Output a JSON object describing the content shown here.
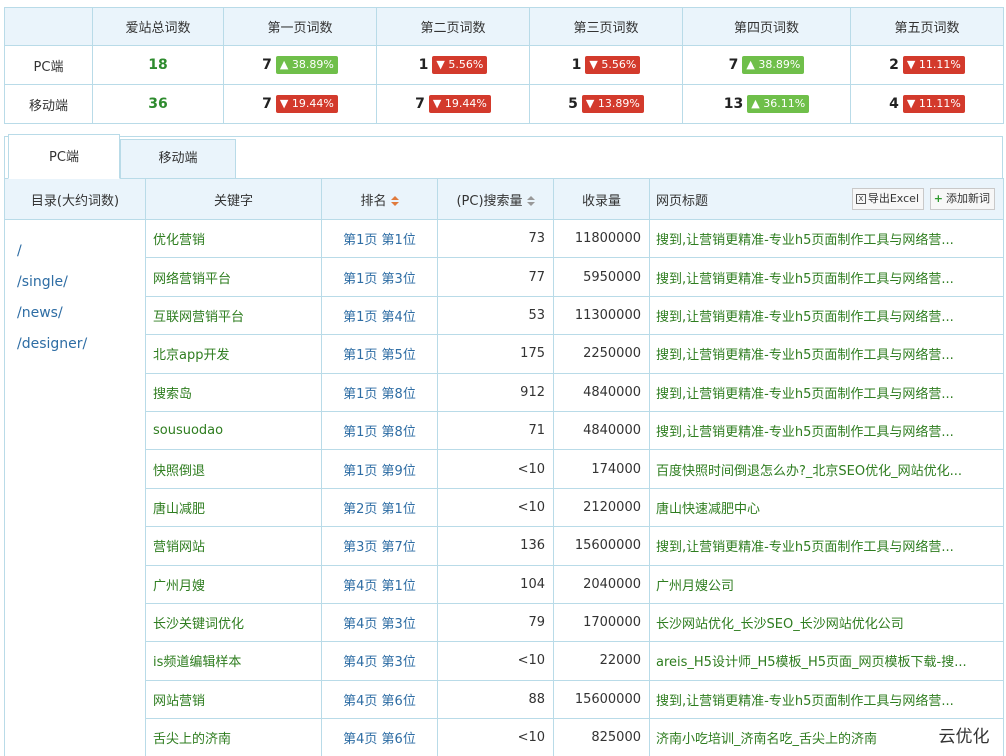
{
  "summary": {
    "headers": [
      "",
      "爱站总词数",
      "第一页词数",
      "第二页词数",
      "第三页词数",
      "第四页词数",
      "第五页词数"
    ],
    "rows": [
      {
        "label": "PC端",
        "total": "18",
        "pages": [
          {
            "count": "7",
            "pct": "38.89%",
            "dir": "up",
            "arrow": "▲"
          },
          {
            "count": "1",
            "pct": "5.56%",
            "dir": "down",
            "arrow": "▼"
          },
          {
            "count": "1",
            "pct": "5.56%",
            "dir": "down",
            "arrow": "▼"
          },
          {
            "count": "7",
            "pct": "38.89%",
            "dir": "up",
            "arrow": "▲"
          },
          {
            "count": "2",
            "pct": "11.11%",
            "dir": "down",
            "arrow": "▼"
          }
        ]
      },
      {
        "label": "移动端",
        "total": "36",
        "pages": [
          {
            "count": "7",
            "pct": "19.44%",
            "dir": "down",
            "arrow": "▼"
          },
          {
            "count": "7",
            "pct": "19.44%",
            "dir": "down",
            "arrow": "▼"
          },
          {
            "count": "5",
            "pct": "13.89%",
            "dir": "down",
            "arrow": "▼"
          },
          {
            "count": "13",
            "pct": "36.11%",
            "dir": "up",
            "arrow": "▲"
          },
          {
            "count": "4",
            "pct": "11.11%",
            "dir": "down",
            "arrow": "▼"
          }
        ]
      }
    ]
  },
  "tabs": [
    {
      "label": "PC端",
      "active": true
    },
    {
      "label": "移动端",
      "active": false
    }
  ],
  "table": {
    "headers": {
      "dir": "目录(大约词数)",
      "keyword": "关键字",
      "rank": "排名",
      "volume": "(PC)搜索量",
      "indexed": "收录量",
      "title": "网页标题"
    },
    "buttons": {
      "export": "导出Excel",
      "export_icon": "X",
      "add": "添加新词",
      "add_icon": "+"
    },
    "dirs": [
      "/",
      "/single/",
      "/news/",
      "/designer/"
    ],
    "rows": [
      {
        "keyword": "优化营销",
        "rank": "第1页 第1位",
        "volume": "73",
        "indexed": "11800000",
        "title": "搜到,让营销更精准-专业h5页面制作工具与网络营..."
      },
      {
        "keyword": "网络营销平台",
        "rank": "第1页 第3位",
        "volume": "77",
        "indexed": "5950000",
        "title": "搜到,让营销更精准-专业h5页面制作工具与网络营..."
      },
      {
        "keyword": "互联网营销平台",
        "rank": "第1页 第4位",
        "volume": "53",
        "indexed": "11300000",
        "title": "搜到,让营销更精准-专业h5页面制作工具与网络营..."
      },
      {
        "keyword": "北京app开发",
        "rank": "第1页 第5位",
        "volume": "175",
        "indexed": "2250000",
        "title": "搜到,让营销更精准-专业h5页面制作工具与网络营..."
      },
      {
        "keyword": "搜索岛",
        "rank": "第1页 第8位",
        "volume": "912",
        "indexed": "4840000",
        "title": "搜到,让营销更精准-专业h5页面制作工具与网络营..."
      },
      {
        "keyword": "sousuodao",
        "rank": "第1页 第8位",
        "volume": "71",
        "indexed": "4840000",
        "title": "搜到,让营销更精准-专业h5页面制作工具与网络营..."
      },
      {
        "keyword": "快照倒退",
        "rank": "第1页 第9位",
        "volume": "<10",
        "indexed": "174000",
        "title": "百度快照时间倒退怎么办?_北京SEO优化_网站优化..."
      },
      {
        "keyword": "唐山减肥",
        "rank": "第2页 第1位",
        "volume": "<10",
        "indexed": "2120000",
        "title": "唐山快速减肥中心"
      },
      {
        "keyword": "营销网站",
        "rank": "第3页 第7位",
        "volume": "136",
        "indexed": "15600000",
        "title": "搜到,让营销更精准-专业h5页面制作工具与网络营..."
      },
      {
        "keyword": "广州月嫂",
        "rank": "第4页 第1位",
        "volume": "104",
        "indexed": "2040000",
        "title": "广州月嫂公司"
      },
      {
        "keyword": "长沙关键词优化",
        "rank": "第4页 第3位",
        "volume": "79",
        "indexed": "1700000",
        "title": "长沙网站优化_长沙SEO_长沙网站优化公司"
      },
      {
        "keyword": "is频道编辑样本",
        "rank": "第4页 第3位",
        "volume": "<10",
        "indexed": "22000",
        "title": "areis_H5设计师_H5模板_H5页面_网页模板下载-搜..."
      },
      {
        "keyword": "网站营销",
        "rank": "第4页 第6位",
        "volume": "88",
        "indexed": "15600000",
        "title": "搜到,让营销更精准-专业h5页面制作工具与网络营..."
      },
      {
        "keyword": "舌尖上的济南",
        "rank": "第4页 第6位",
        "volume": "<10",
        "indexed": "825000",
        "title": "济南小吃培训_济南名吃_舌尖上的济南"
      }
    ]
  },
  "watermark": "云优化"
}
